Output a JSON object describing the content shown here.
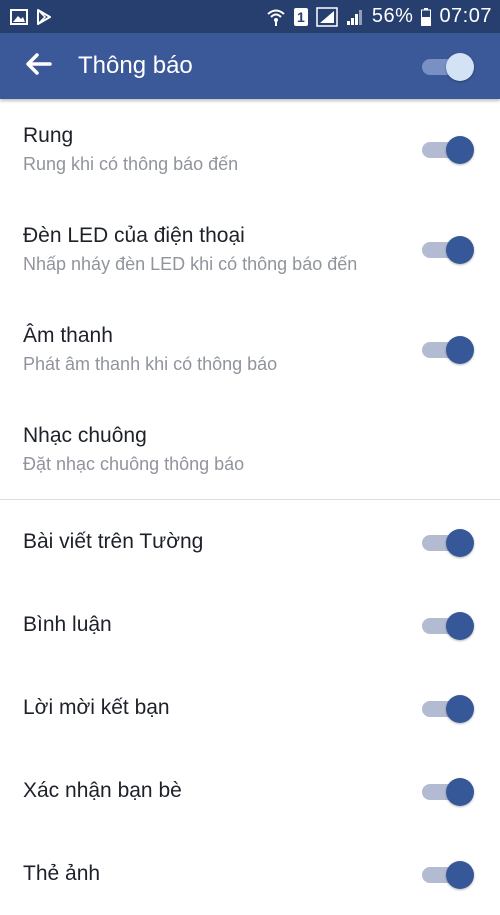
{
  "status_bar": {
    "battery_percent": "56%",
    "time": "07:07",
    "sim_slot": "1"
  },
  "app_bar": {
    "title": "Thông báo",
    "back_icon": "arrow-left-icon",
    "master_toggle_on": true
  },
  "colors": {
    "status_bar": "#263f6e",
    "app_bar": "#3b5998",
    "toggle_thumb": "#365899",
    "toggle_track": "#b3bbd2",
    "title_text": "#1d2129",
    "subtitle_text": "#90949c"
  },
  "settings": [
    {
      "title": "Rung",
      "subtitle": "Rung khi có thông báo đến",
      "toggle": true
    },
    {
      "title": "Đèn LED của điện thoại",
      "subtitle": "Nhấp nháy đèn LED khi có thông báo đến",
      "toggle": true
    },
    {
      "title": "Âm thanh",
      "subtitle": "Phát âm thanh khi có thông báo",
      "toggle": true
    },
    {
      "title": "Nhạc chuông",
      "subtitle": "Đặt nhạc chuông thông báo",
      "toggle": null
    }
  ],
  "categories": [
    {
      "title": "Bài viết trên Tường",
      "toggle": true
    },
    {
      "title": "Bình luận",
      "toggle": true
    },
    {
      "title": "Lời mời kết bạn",
      "toggle": true
    },
    {
      "title": "Xác nhận bạn bè",
      "toggle": true
    },
    {
      "title": "Thẻ ảnh",
      "toggle": true
    }
  ]
}
